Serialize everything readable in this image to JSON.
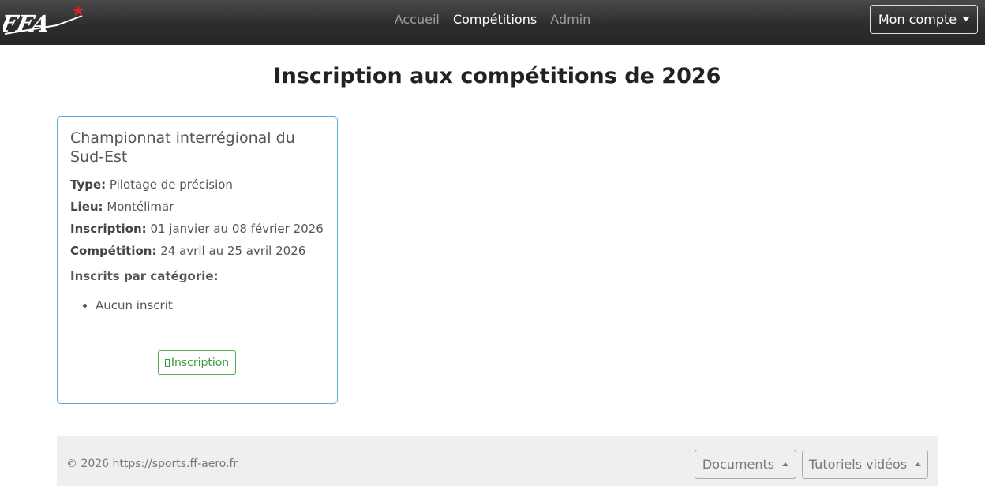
{
  "nav": {
    "logo_text": "FFA",
    "links": [
      "Accueil",
      "Compétitions",
      "Admin"
    ],
    "account_label": "Mon compte"
  },
  "main": {
    "title": "Inscription aux compétitions de 2026"
  },
  "card": {
    "title": "Championnat interrégional du Sud-Est",
    "type_label": "Type:",
    "type_value": "Pilotage de précision",
    "lieu_label": "Lieu:",
    "lieu_value": "Montélimar",
    "inscription_label": "Inscription:",
    "inscription_value": "01 janvier au 08 février 2026",
    "competition_label": "Compétition:",
    "competition_value": "24 avril au 25 avril 2026",
    "categories_label": "Inscrits par catégorie:",
    "categories": [
      "Aucun inscrit"
    ],
    "button_label": "Inscription"
  },
  "footer": {
    "copyright": "© 2026 https://sports.ff-aero.fr",
    "documents_label": "Documents",
    "tutorials_label": "Tutoriels vidéos"
  },
  "colors": {
    "navbar": "#2d2d2d",
    "card_border": "#5aa7db",
    "button_green": "#4cae4c",
    "logo_star": "#d9232a"
  }
}
